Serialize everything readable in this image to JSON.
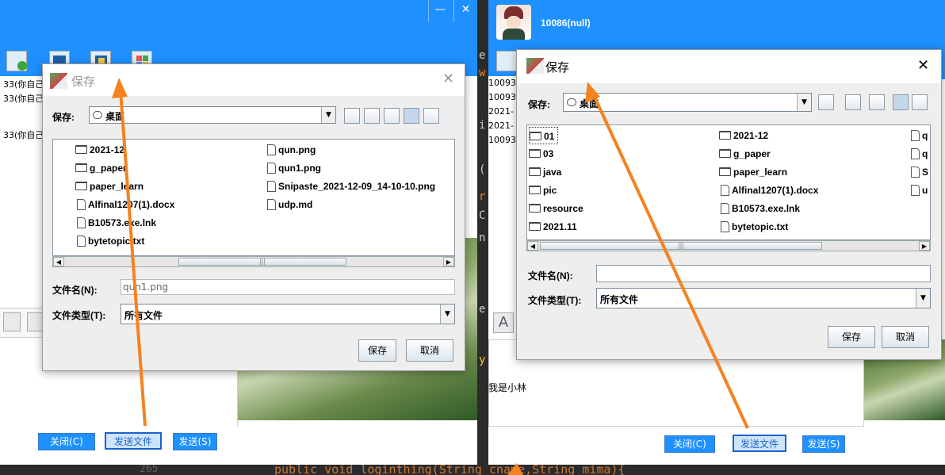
{
  "left_chat": {
    "messages": [
      "33(你自己",
      "33(你自己",
      "33(你自己"
    ],
    "buttons": {
      "close": "关闭(C)",
      "send_file": "发送文件",
      "send": "发送(S)"
    }
  },
  "right_chat": {
    "contact": "10086(null)",
    "messages": [
      "10093",
      "10093",
      "2021-",
      "2021-",
      "10093"
    ],
    "chat_text": "我是小林",
    "buttons": {
      "close": "关闭(C)",
      "send_file": "发送文件",
      "send": "发送(S)"
    }
  },
  "dialog_left": {
    "title": "保存",
    "save_in_label": "保存:",
    "location": "桌面",
    "files_col1": [
      {
        "name": "2021-12",
        "type": "dir"
      },
      {
        "name": "g_paper",
        "type": "dir"
      },
      {
        "name": "paper_learn",
        "type": "dir"
      },
      {
        "name": "Alfinal1207(1).docx",
        "type": "file"
      },
      {
        "name": "B10573.exe.lnk",
        "type": "file"
      },
      {
        "name": "bytetopic.txt",
        "type": "file"
      }
    ],
    "files_col2": [
      {
        "name": "qun.png",
        "type": "file"
      },
      {
        "name": "qun1.png",
        "type": "file"
      },
      {
        "name": "Snipaste_2021-12-09_14-10-10.png",
        "type": "file"
      },
      {
        "name": "udp.md",
        "type": "file"
      }
    ],
    "filename_label": "文件名(N):",
    "filename_value": "qun1.png",
    "filetype_label": "文件类型(T):",
    "filetype_value": "所有文件",
    "save_button": "保存",
    "cancel_button": "取消"
  },
  "dialog_right": {
    "title": "保存",
    "save_in_label": "保存:",
    "location": "桌面",
    "files_col1": [
      {
        "name": "01",
        "type": "dir"
      },
      {
        "name": "03",
        "type": "dir"
      },
      {
        "name": "java",
        "type": "dir"
      },
      {
        "name": "pic",
        "type": "dir"
      },
      {
        "name": "resource",
        "type": "dir"
      },
      {
        "name": "2021.11",
        "type": "dir"
      }
    ],
    "files_col2": [
      {
        "name": "2021-12",
        "type": "dir"
      },
      {
        "name": "g_paper",
        "type": "dir"
      },
      {
        "name": "paper_learn",
        "type": "dir"
      },
      {
        "name": "Alfinal1207(1).docx",
        "type": "file"
      },
      {
        "name": "B10573.exe.lnk",
        "type": "file"
      },
      {
        "name": "bytetopic.txt",
        "type": "file"
      }
    ],
    "files_col3": [
      {
        "name": "q",
        "type": "file"
      },
      {
        "name": "q",
        "type": "file"
      },
      {
        "name": "S",
        "type": "file"
      },
      {
        "name": "u",
        "type": "file"
      }
    ],
    "filename_label": "文件名(N):",
    "filename_value": "",
    "filetype_label": "文件类型(T):",
    "filetype_value": "所有文件",
    "save_button": "保存",
    "cancel_button": "取消"
  },
  "code_line": {
    "line_number": "265",
    "text": "public void loginthing(String cname,String mima){"
  },
  "editor_letters": [
    "e",
    "w",
    "i",
    "(",
    "r",
    "C",
    "n",
    "e",
    "y"
  ],
  "window_controls": {
    "minimize": "—",
    "close": "✕"
  },
  "colors": {
    "title_blue": "#1e90ff",
    "arrow": "#f5821f",
    "editor_bg": "#2b2b2b"
  }
}
